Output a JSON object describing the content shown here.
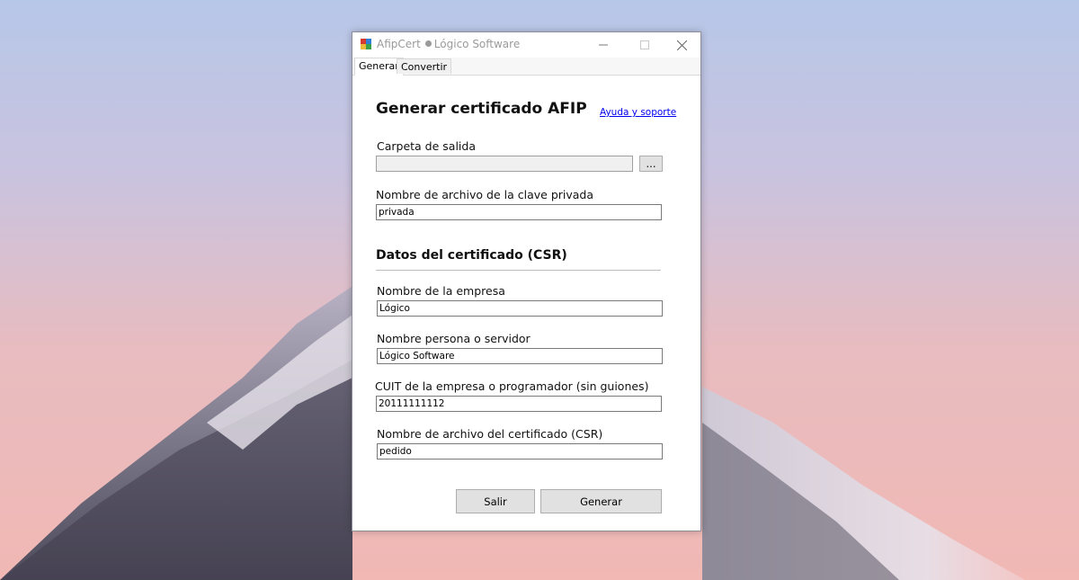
{
  "window": {
    "title_app": "AfipCert",
    "title_company": "Lógico Software"
  },
  "tabs": [
    {
      "label": "Generar",
      "active": true
    },
    {
      "label": "Convertir",
      "active": false
    }
  ],
  "form": {
    "heading": "Generar certificado AFIP",
    "help_link": "Ayuda y soporte",
    "output_folder_label": "Carpeta de salida",
    "output_folder_value": "",
    "browse_label": "...",
    "private_key_label": "Nombre de archivo de la clave privada",
    "private_key_value": "privada",
    "csr_section_title": "Datos del certificado (CSR)",
    "company_label": "Nombre de la empresa",
    "company_value": "Lógico",
    "person_label": "Nombre persona o servidor",
    "person_value": "Lógico Software",
    "cuit_label": "CUIT de la empresa o programador (sin guiones)",
    "cuit_value": "20111111112",
    "csr_filename_label": "Nombre de archivo del certificado (CSR)",
    "csr_filename_value": "pedido",
    "exit_label": "Salir",
    "generate_label": "Generar"
  },
  "colors": {
    "link": "#0000ee",
    "button_bg": "#e1e1e1",
    "sky_top": "#b7c7e8",
    "sky_bottom": "#f1b8b4"
  }
}
